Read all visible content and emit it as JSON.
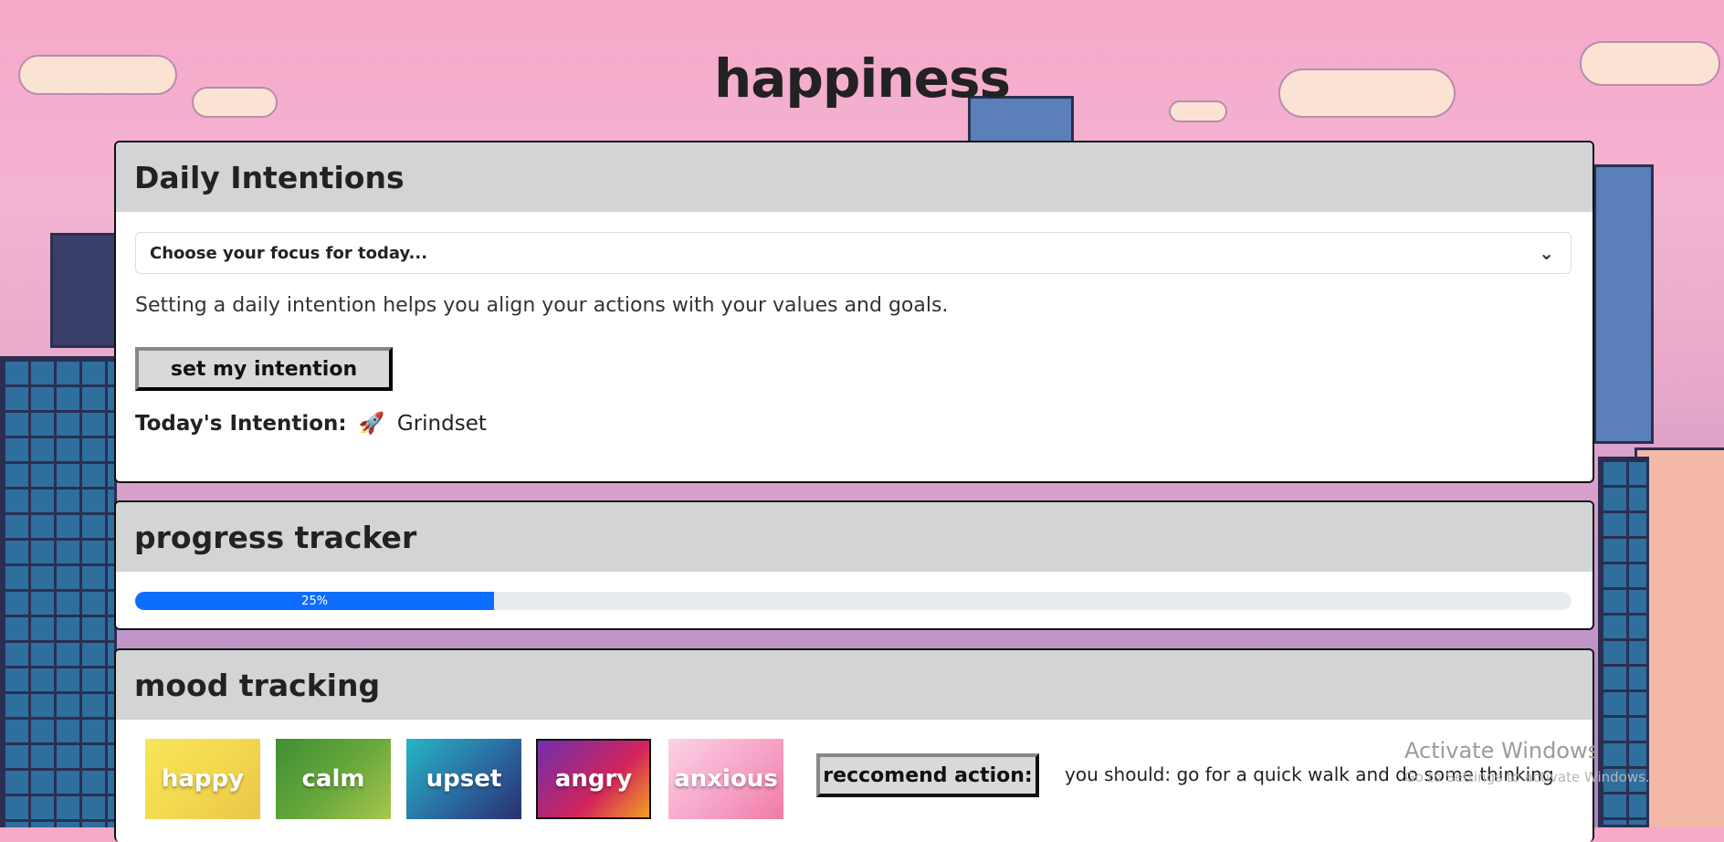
{
  "header": {
    "title": "happiness"
  },
  "intentions": {
    "heading": "Daily Intentions",
    "select_placeholder": "Choose your focus for today...",
    "help_text": "Setting a daily intention helps you align your actions with your values and goals.",
    "set_button": "set my intention",
    "today_label": "Today's Intention:",
    "today_icon": "🚀",
    "today_value": "Grindset"
  },
  "progress": {
    "heading": "progress tracker",
    "percent": 25,
    "label": "25%",
    "color": "#0d6efd"
  },
  "mood": {
    "heading": "mood tracking",
    "options": [
      {
        "label": "happy",
        "gradient": "linear-gradient(135deg,#f7e65a,#f3d84f 50%,#e9c64b)"
      },
      {
        "label": "calm",
        "gradient": "linear-gradient(135deg,#3e8f34,#6aa93c 55%,#a8c64c)"
      },
      {
        "label": "upset",
        "gradient": "linear-gradient(135deg,#28b6c6,#2a6aa0 55%,#2b2f6e)"
      },
      {
        "label": "angry",
        "gradient": "linear-gradient(135deg,#6f2fae,#d2245b 60%,#f4a021)"
      },
      {
        "label": "anxious",
        "gradient": "linear-gradient(135deg,#fbd3e6,#f6a3c8 55%,#f07aa6)"
      }
    ],
    "recommend_button": "reccomend action:",
    "suggestion": "you should: go for a quick walk and do some thinking"
  },
  "system": {
    "watermark_title": "Activate Windows",
    "watermark_sub": "Go to Settings to activate Windows."
  }
}
